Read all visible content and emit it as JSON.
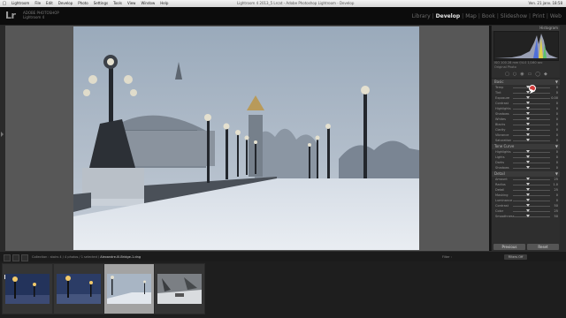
{
  "menubar": {
    "apple_icon": "apple-icon",
    "items": [
      "Lightroom",
      "File",
      "Edit",
      "Develop",
      "Photo",
      "Settings",
      "Tools",
      "View",
      "Window",
      "Help"
    ],
    "window_title": "Lightroom 4 2013_5 Lrcat - Adobe Photoshop Lightroom - Develop",
    "clock": "Ven. 21 janv.  18:58"
  },
  "identity": {
    "logo": "Lr",
    "product_line1": "ADOBE PHOTOSHOP",
    "product_line2": "Lightroom 4"
  },
  "modules": [
    "Library",
    "Develop",
    "Map",
    "Book",
    "Slideshow",
    "Print",
    "Web"
  ],
  "active_module": "Develop",
  "right_panel": {
    "histogram_title": "Histogram",
    "histogram_info": "ISO 100   28 mm   f/4.0   1/160 sec",
    "original_label": "Original Photo",
    "tool_icons": [
      "crop-icon",
      "spot-removal-icon",
      "red-eye-icon",
      "graduated-filter-icon",
      "radial-filter-icon",
      "brush-icon"
    ],
    "basic_section": {
      "title": "Basic",
      "toggle": "▼"
    },
    "basic_sliders": [
      {
        "label": "Temp",
        "value": "0"
      },
      {
        "label": "Tint",
        "value": "0"
      },
      {
        "label": "Exposure",
        "value": "0.00"
      },
      {
        "label": "Contrast",
        "value": "0"
      },
      {
        "label": "Highlights",
        "value": "0"
      },
      {
        "label": "Shadows",
        "value": "0"
      },
      {
        "label": "Whites",
        "value": "0"
      },
      {
        "label": "Blacks",
        "value": "0"
      },
      {
        "label": "Clarity",
        "value": "0"
      },
      {
        "label": "Vibrance",
        "value": "0"
      },
      {
        "label": "Saturation",
        "value": "0"
      }
    ],
    "tone_section": {
      "title": "Tone Curve",
      "toggle": "▼"
    },
    "tone_sliders": [
      {
        "label": "Highlights",
        "value": "0"
      },
      {
        "label": "Lights",
        "value": "0"
      },
      {
        "label": "Darks",
        "value": "0"
      },
      {
        "label": "Shadows",
        "value": "0"
      }
    ],
    "detail_section": {
      "title": "Detail",
      "toggle": "▼"
    },
    "detail_sliders": [
      {
        "label": "Amount",
        "value": "25"
      },
      {
        "label": "Radius",
        "value": "1.0"
      },
      {
        "label": "Detail",
        "value": "25"
      },
      {
        "label": "Masking",
        "value": "0"
      },
      {
        "label": "Luminance",
        "value": "0"
      },
      {
        "label": "Contrast",
        "value": "50"
      },
      {
        "label": "Color",
        "value": "25"
      },
      {
        "label": "Smoothness",
        "value": "50"
      }
    ],
    "buttons": {
      "previous": "Previous",
      "reset": "Reset"
    }
  },
  "toolbar": {
    "path_prefix": "Collection : stairs 4  /  4 photos / 1 selected /",
    "filename": "Alexandre-III-Bridge-1.dng",
    "filter_label": "Filter :",
    "filter_value": "Filters Off"
  },
  "filmstrip": {
    "selected_index": 2,
    "badge": "1"
  }
}
